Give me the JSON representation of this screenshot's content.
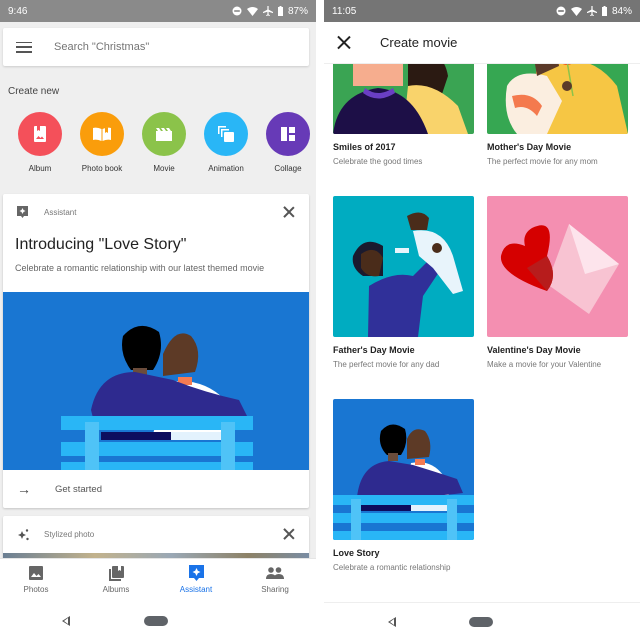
{
  "left_screen": {
    "status_bar": {
      "time": "9:46",
      "battery": "87%",
      "icons": [
        "do-not-disturb-icon",
        "wifi-icon",
        "airplane-icon",
        "battery-icon"
      ]
    },
    "search": {
      "placeholder": "Search \"Christmas\"",
      "menu_icon": "hamburger-menu-icon"
    },
    "create_new": {
      "heading": "Create new",
      "items": [
        {
          "label": "Album",
          "icon": "album-icon",
          "color": "#f4505a"
        },
        {
          "label": "Photo book",
          "icon": "photo-book-icon",
          "color": "#fa9d0b"
        },
        {
          "label": "Movie",
          "icon": "movie-icon",
          "color": "#8bc34a"
        },
        {
          "label": "Animation",
          "icon": "animation-icon",
          "color": "#29b6f6"
        },
        {
          "label": "Collage",
          "icon": "collage-icon",
          "color": "#673ab7"
        }
      ]
    },
    "assistant_card": {
      "label": "Assistant",
      "title": "Introducing \"Love Story\"",
      "subtitle": "Celebrate a romantic relationship with our latest themed movie",
      "action": "Get started"
    },
    "stylized_card": {
      "label": "Stylized photo"
    },
    "bottom_nav": {
      "items": [
        {
          "label": "Photos",
          "icon": "photos-icon",
          "active": false
        },
        {
          "label": "Albums",
          "icon": "albums-icon",
          "active": false
        },
        {
          "label": "Assistant",
          "icon": "assistant-icon",
          "active": true
        },
        {
          "label": "Sharing",
          "icon": "sharing-icon",
          "active": false
        }
      ],
      "active_color": "#1a73e8"
    }
  },
  "right_screen": {
    "status_bar": {
      "time": "11:05",
      "battery": "84%",
      "icons": [
        "do-not-disturb-icon",
        "wifi-icon",
        "airplane-icon",
        "battery-icon"
      ]
    },
    "app_bar": {
      "title": "Create movie",
      "close_icon": "close-icon"
    },
    "movies": [
      {
        "title": "Smiles of 2017",
        "subtitle": "Celebrate the good times"
      },
      {
        "title": "Mother's Day Movie",
        "subtitle": "The perfect movie for any mom"
      },
      {
        "title": "Father's Day Movie",
        "subtitle": "The perfect movie for any dad"
      },
      {
        "title": "Valentine's Day Movie",
        "subtitle": "Make a movie for your Valentine"
      },
      {
        "title": "Love Story",
        "subtitle": "Celebrate a romantic relationship"
      }
    ]
  }
}
